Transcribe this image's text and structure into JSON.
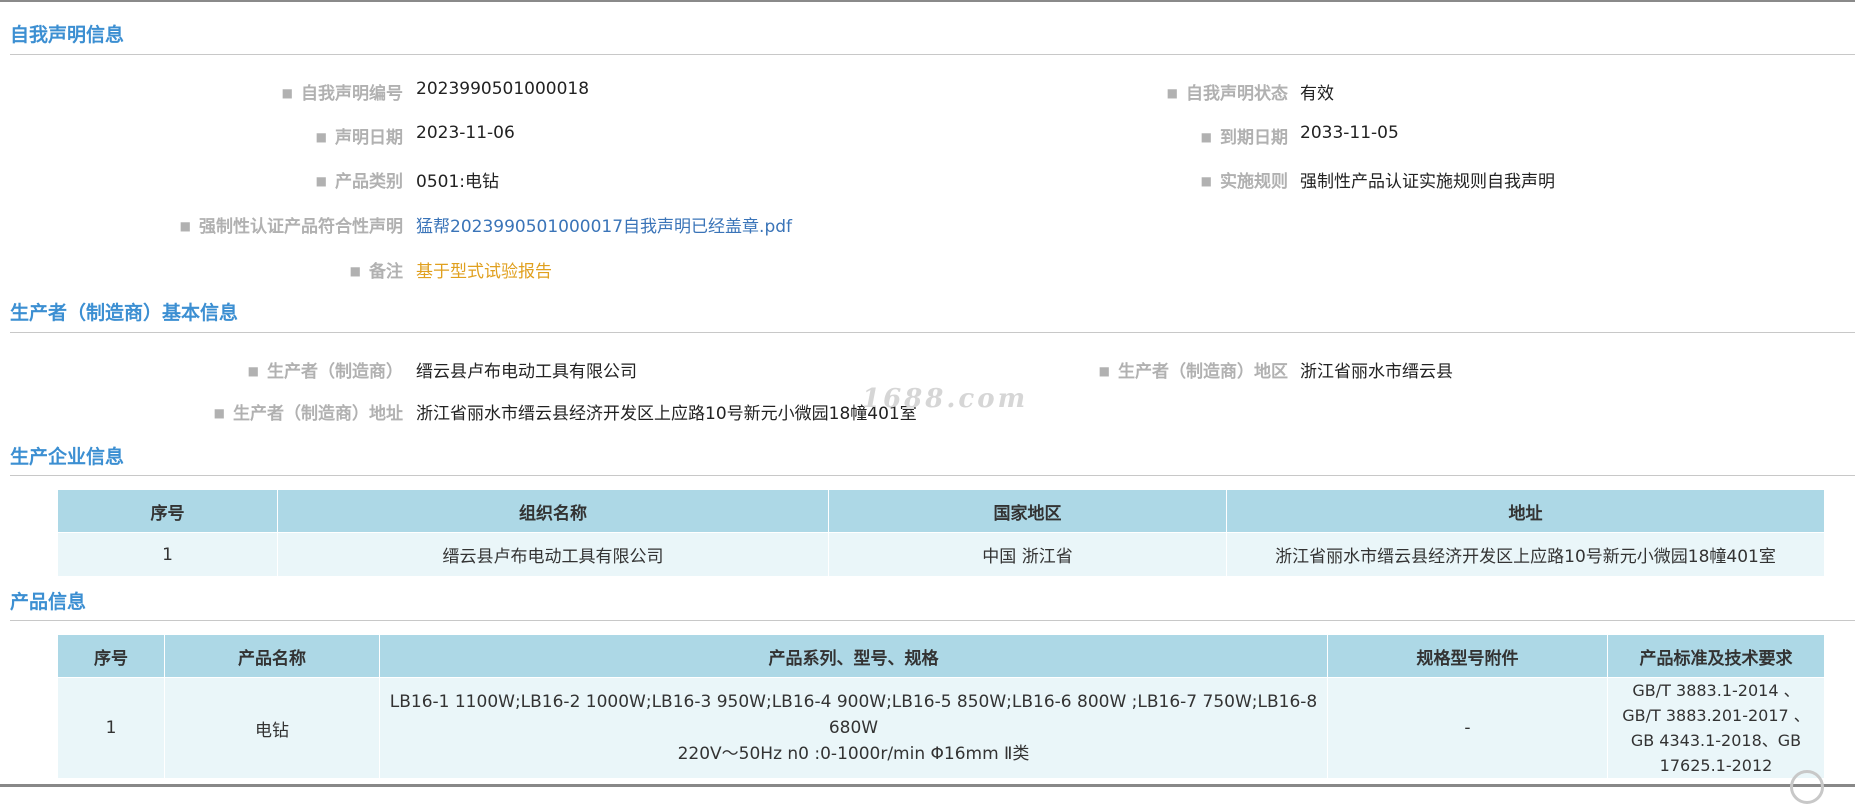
{
  "sections": {
    "declaration": "自我声明信息",
    "manufacturer": "生产者（制造商）基本信息",
    "enterprise": "生产企业信息",
    "product": "产品信息"
  },
  "declaration": {
    "number_label": "自我声明编号",
    "number_value": "2023990501000018",
    "status_label": "自我声明状态",
    "status_value": "有效",
    "date_label": "声明日期",
    "date_value": "2023-11-06",
    "expiry_label": "到期日期",
    "expiry_value": "2033-11-05",
    "category_label": "产品类别",
    "category_value": "0501:电钻",
    "rule_label": "实施规则",
    "rule_value": "强制性产品认证实施规则自我声明",
    "conformity_label": "强制性认证产品符合性声明",
    "conformity_value": "猛帮2023990501000017自我声明已经盖章.pdf",
    "remark_label": "备注",
    "remark_value": "基于型式试验报告"
  },
  "manufacturer": {
    "name_label": "生产者（制造商）",
    "name_value": "缙云县卢布电动工具有限公司",
    "region_label": "生产者（制造商）地区",
    "region_value": "浙江省丽水市缙云县",
    "address_label": "生产者（制造商）地址",
    "address_value": "浙江省丽水市缙云县经济开发区上应路10号新元小微园18幢401室"
  },
  "watermark": "1688.com",
  "enterprise_table": {
    "headers": [
      "序号",
      "组织名称",
      "国家地区",
      "地址"
    ],
    "rows": [
      [
        "1",
        "缙云县卢布电动工具有限公司",
        "中国 浙江省",
        "浙江省丽水市缙云县经济开发区上应路10号新元小微园18幢401室"
      ]
    ]
  },
  "product_table": {
    "headers": [
      "序号",
      "产品名称",
      "产品系列、型号、规格",
      "规格型号附件",
      "产品标准及技术要求"
    ],
    "rows": [
      {
        "index": "1",
        "name": "电钻",
        "spec_line1": "LB16-1 1100W;LB16-2 1000W;LB16-3 950W;LB16-4 900W;LB16-5 850W;LB16-6 800W ;LB16-7 750W;LB16-8 680W",
        "spec_line2": "220V～50Hz n0 :0-1000r/min Φ16mm Ⅱ类",
        "accessory": "-",
        "standard": "GB/T 3883.1-2014 、GB/T 3883.201-2017 、GB 4343.1-2018、GB 17625.1-2012"
      }
    ]
  }
}
